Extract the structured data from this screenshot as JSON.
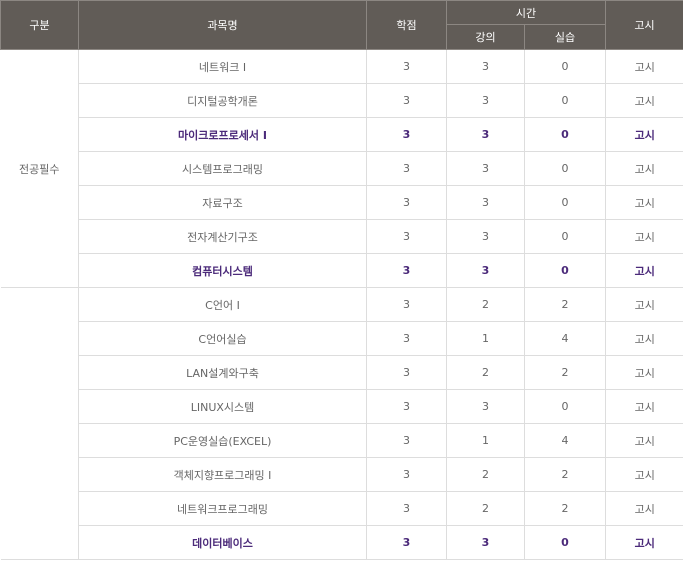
{
  "header": {
    "category": "구분",
    "course_name": "과목명",
    "credits": "학점",
    "hours": "시간",
    "lecture": "강의",
    "practice": "실습",
    "exam": "고시"
  },
  "groups": [
    {
      "category": "전공필수",
      "rows": [
        {
          "name": "네트워크 I",
          "credits": "3",
          "lecture": "3",
          "practice": "0",
          "exam": "고시",
          "highlight": false
        },
        {
          "name": "디지털공학개론",
          "credits": "3",
          "lecture": "3",
          "practice": "0",
          "exam": "고시",
          "highlight": false
        },
        {
          "name": "마이크로프로세서 I",
          "credits": "3",
          "lecture": "3",
          "practice": "0",
          "exam": "고시",
          "highlight": true
        },
        {
          "name": "시스템프로그래밍",
          "credits": "3",
          "lecture": "3",
          "practice": "0",
          "exam": "고시",
          "highlight": false
        },
        {
          "name": "자료구조",
          "credits": "3",
          "lecture": "3",
          "practice": "0",
          "exam": "고시",
          "highlight": false
        },
        {
          "name": "전자계산기구조",
          "credits": "3",
          "lecture": "3",
          "practice": "0",
          "exam": "고시",
          "highlight": false
        },
        {
          "name": "컴퓨터시스템",
          "credits": "3",
          "lecture": "3",
          "practice": "0",
          "exam": "고시",
          "highlight": true
        }
      ]
    },
    {
      "category": "",
      "rows": [
        {
          "name": "C언어 I",
          "credits": "3",
          "lecture": "2",
          "practice": "2",
          "exam": "고시",
          "highlight": false
        },
        {
          "name": "C언어실습",
          "credits": "3",
          "lecture": "1",
          "practice": "4",
          "exam": "고시",
          "highlight": false
        },
        {
          "name": "LAN설계와구축",
          "credits": "3",
          "lecture": "2",
          "practice": "2",
          "exam": "고시",
          "highlight": false
        },
        {
          "name": "LINUX시스템",
          "credits": "3",
          "lecture": "3",
          "practice": "0",
          "exam": "고시",
          "highlight": false
        },
        {
          "name": "PC운영실습(EXCEL)",
          "credits": "3",
          "lecture": "1",
          "practice": "4",
          "exam": "고시",
          "highlight": false
        },
        {
          "name": "객체지향프로그래밍 I",
          "credits": "3",
          "lecture": "2",
          "practice": "2",
          "exam": "고시",
          "highlight": false
        },
        {
          "name": "네트워크프로그래밍",
          "credits": "3",
          "lecture": "2",
          "practice": "2",
          "exam": "고시",
          "highlight": false
        },
        {
          "name": "데이터베이스",
          "credits": "3",
          "lecture": "3",
          "practice": "0",
          "exam": "고시",
          "highlight": true
        }
      ]
    }
  ]
}
